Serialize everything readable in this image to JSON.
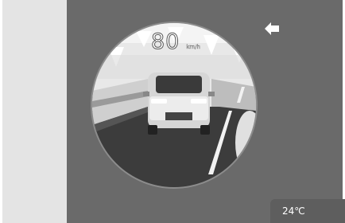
{
  "speed": {
    "value": "80",
    "unit": "km/h"
  },
  "climate": {
    "temperature": "24℃"
  },
  "icons": {
    "back": "back-arrow-icon"
  },
  "colors": {
    "main_bg": "#6a6a6a",
    "side_panel": "#e4e4e4",
    "temp_card": "#5e5e5e",
    "text": "#ffffff"
  }
}
